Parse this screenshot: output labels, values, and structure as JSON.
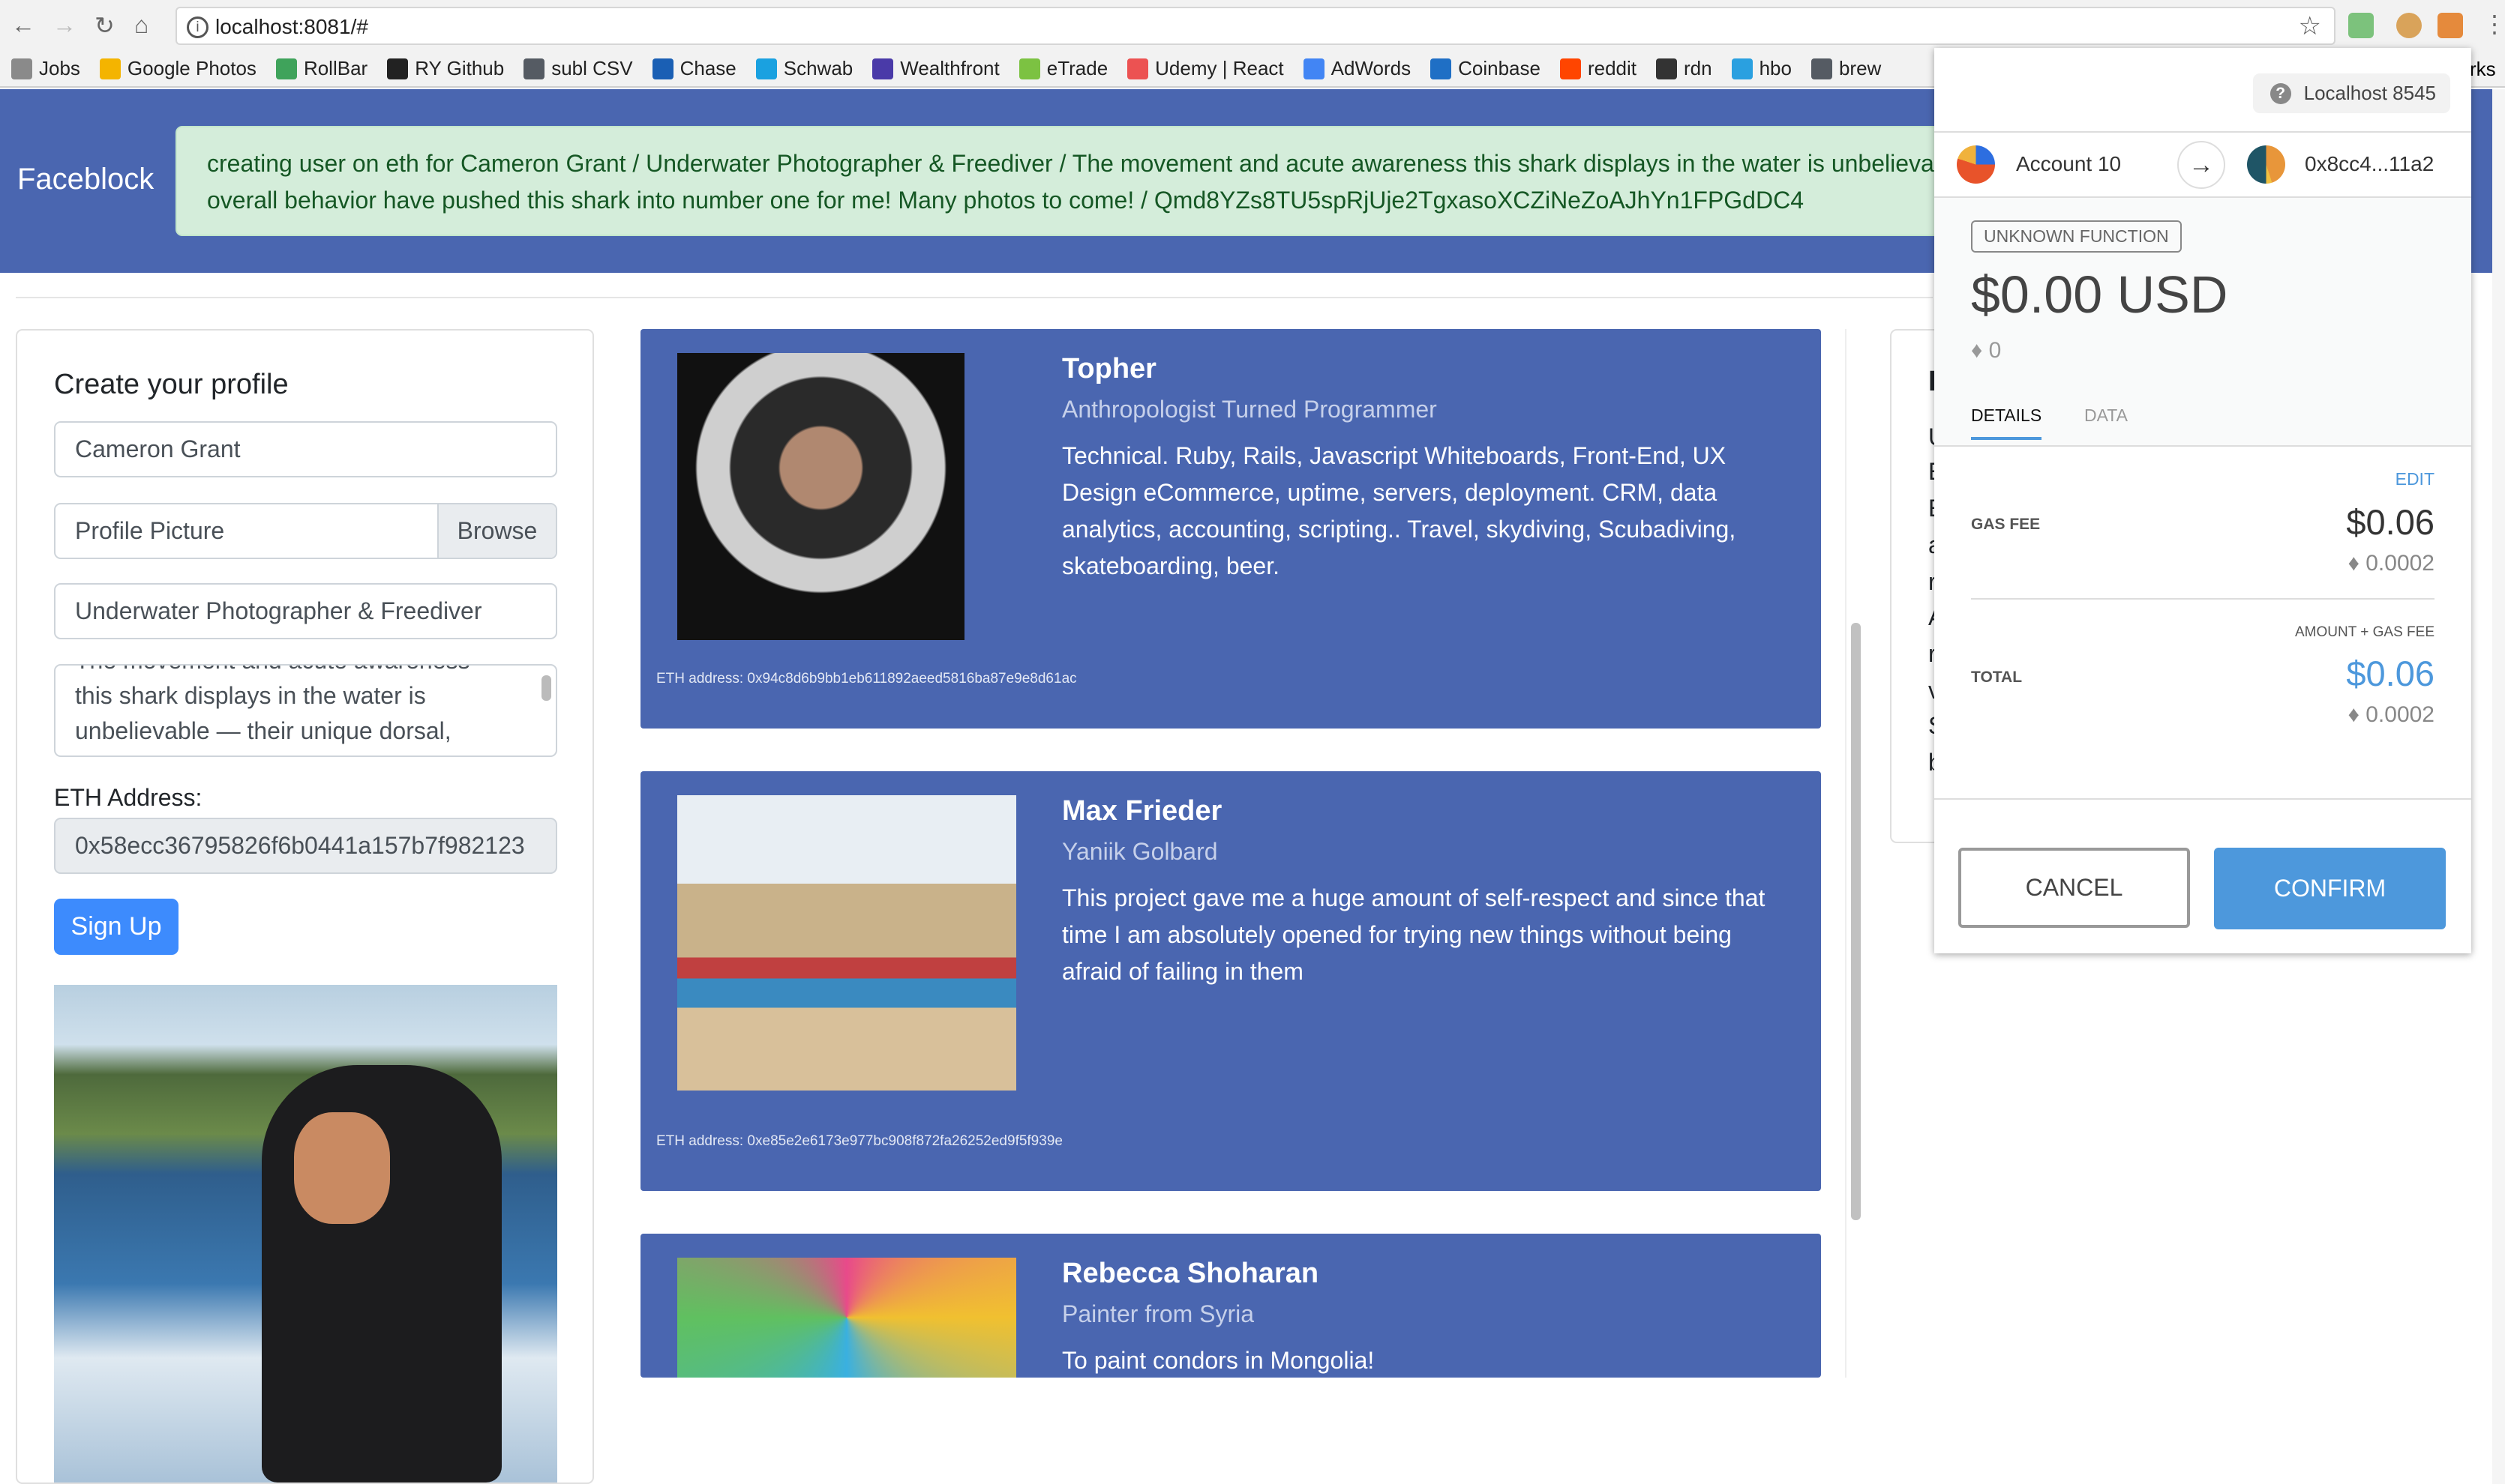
{
  "browser": {
    "url": "localhost:8081/#",
    "bookmarks": [
      {
        "label": "Jobs",
        "color": "#8a8a8a"
      },
      {
        "label": "Google Photos",
        "color": "#f4b400"
      },
      {
        "label": "RollBar",
        "color": "#3fa35b"
      },
      {
        "label": "RY Github",
        "color": "#222222"
      },
      {
        "label": "subl CSV",
        "color": "#555b63"
      },
      {
        "label": "Chase",
        "color": "#1a5fb4"
      },
      {
        "label": "Schwab",
        "color": "#1aa1e0"
      },
      {
        "label": "Wealthfront",
        "color": "#4a3aa8"
      },
      {
        "label": "eTrade",
        "color": "#7cc242"
      },
      {
        "label": "Udemy | React",
        "color": "#ec5252"
      },
      {
        "label": "AdWords",
        "color": "#4285f4"
      },
      {
        "label": "Coinbase",
        "color": "#1f6fc5"
      },
      {
        "label": "reddit",
        "color": "#ff4500"
      },
      {
        "label": "rdn",
        "color": "#333333"
      },
      {
        "label": "hbo",
        "color": "#2aa0e0"
      },
      {
        "label": "brew",
        "color": "#555b63"
      }
    ],
    "bookmarks_overflow": "rks"
  },
  "header": {
    "brand": "Faceblock",
    "alert_line1": "creating user on eth for Cameron Grant / Underwater Photographer & Freediver / The movement and acute awareness this shark displays in the water is unbelievable — their unique dorsal,",
    "alert_line2": "overall behavior have pushed this shark into number one for me! Many photos to come! / Qmd8YZs8TU5spRjUje2TgxasoXCZiNeZoAJhYn1FPGdDC4"
  },
  "form": {
    "title": "Create your profile",
    "name_value": "Cameron Grant",
    "picture_placeholder": "Profile Picture",
    "browse_label": "Browse",
    "title_value": "Underwater Photographer & Freediver",
    "bio_value": "The movement and acute awareness this shark displays in the water is unbelievable — their unique dorsal,",
    "eth_label": "ETH Address:",
    "eth_value": "0x58ecc36795826f6b0441a157b7f982123",
    "signup_label": "Sign Up"
  },
  "profiles": [
    {
      "name": "Topher",
      "title": "Anthropologist Turned Programmer",
      "description": "Technical. Ruby, Rails, Javascript Whiteboards, Front-End, UX Design eCommerce, uptime, servers, deployment. CRM, data analytics, accounting, scripting.. Travel, skydiving, Scubadiving, skateboarding, beer.",
      "eth": "ETH address: 0x94c8d6b9bb1eb611892aeed5816ba87e9e8d61ac"
    },
    {
      "name": "Max Frieder",
      "title": "Yaniik Golbard",
      "description": "This project gave me a huge amount of self-respect and since that time I am absolutely opened for trying new things without being afraid of failing in them",
      "eth": "ETH address: 0xe85e2e6173e977bc908f872fa26252ed9f5f939e"
    },
    {
      "name": "Rebecca Shoharan",
      "title": "Painter from Syria",
      "description": "To paint condors in Mongolia!",
      "eth": ""
    }
  ],
  "right_card_letters": [
    "F",
    "U",
    "E",
    "E",
    "a",
    "r",
    "A",
    "r",
    "v",
    "S",
    "b"
  ],
  "metamask": {
    "network": "Localhost 8545",
    "from_account": "Account 10",
    "to_address": "0x8cc4...11a2",
    "function_badge": "UNKNOWN FUNCTION",
    "amount_usd": "$0.00 USD",
    "amount_eth": "♦ 0",
    "tabs": [
      {
        "label": "DETAILS",
        "active": true
      },
      {
        "label": "DATA",
        "active": false
      }
    ],
    "edit_label": "EDIT",
    "gas_fee_label": "GAS FEE",
    "gas_fee_usd": "$0.06",
    "gas_fee_eth": "♦ 0.0002",
    "total_sub_label": "AMOUNT + GAS FEE",
    "total_label": "TOTAL",
    "total_usd": "$0.06",
    "total_eth": "♦ 0.0002",
    "cancel_label": "CANCEL",
    "confirm_label": "CONFIRM",
    "accent": "#4d98dc"
  }
}
